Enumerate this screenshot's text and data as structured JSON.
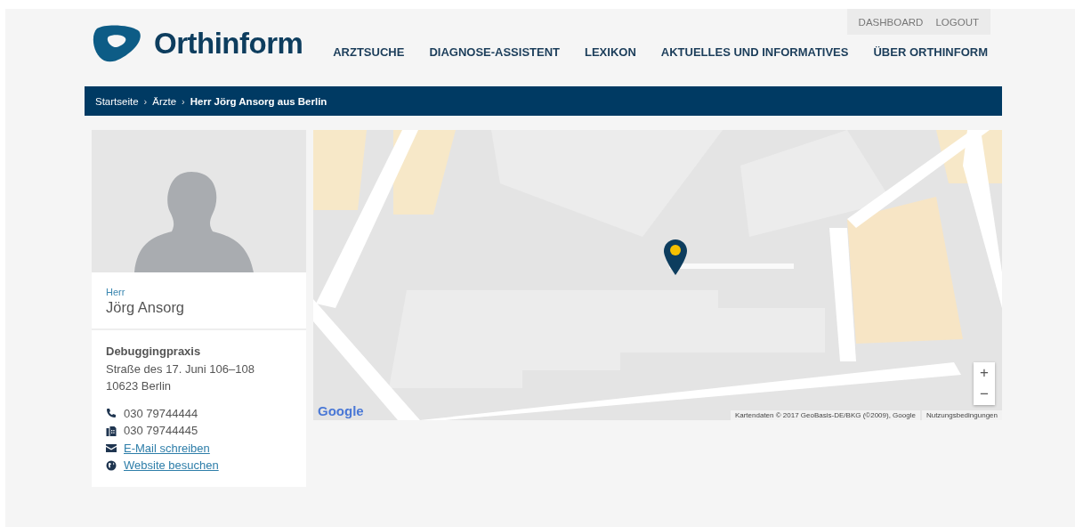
{
  "header": {
    "logo_text": "Orthinform",
    "account_links": [
      "DASHBOARD",
      "LOGOUT"
    ],
    "nav": [
      {
        "label": "ARZTSUCHE"
      },
      {
        "label": "DIAGNOSE-ASSISTENT"
      },
      {
        "label": "LEXIKON"
      },
      {
        "label": "AKTUELLES UND INFORMATIVES"
      },
      {
        "label": "ÜBER ORTHINFORM"
      }
    ]
  },
  "breadcrumb": [
    {
      "label": "Startseite",
      "current": false
    },
    {
      "separator": "›",
      "label": "Ärzte",
      "current": false
    },
    {
      "separator": "›",
      "label": "Herr Jörg Ansorg aus Berlin",
      "current": true
    }
  ],
  "profile": {
    "salutation": "Herr",
    "name": "Jörg Ansorg",
    "practice": "Debuggingpraxis",
    "street": "Straße des 17. Juni 106–108",
    "city": "10623 Berlin",
    "contacts": [
      {
        "kind": "phone",
        "text": "030 79744444"
      },
      {
        "kind": "fax",
        "text": "030 79744445"
      },
      {
        "kind": "email",
        "text": "E-Mail schreiben"
      },
      {
        "kind": "web",
        "text": "Website besuchen"
      }
    ]
  },
  "map": {
    "logo": "Google",
    "zoom_in": "+",
    "zoom_out": "−",
    "attribution": "Kartendaten © 2017 GeoBasis-DE/BKG (©2009), Google",
    "terms": "Nutzungsbedingungen"
  }
}
